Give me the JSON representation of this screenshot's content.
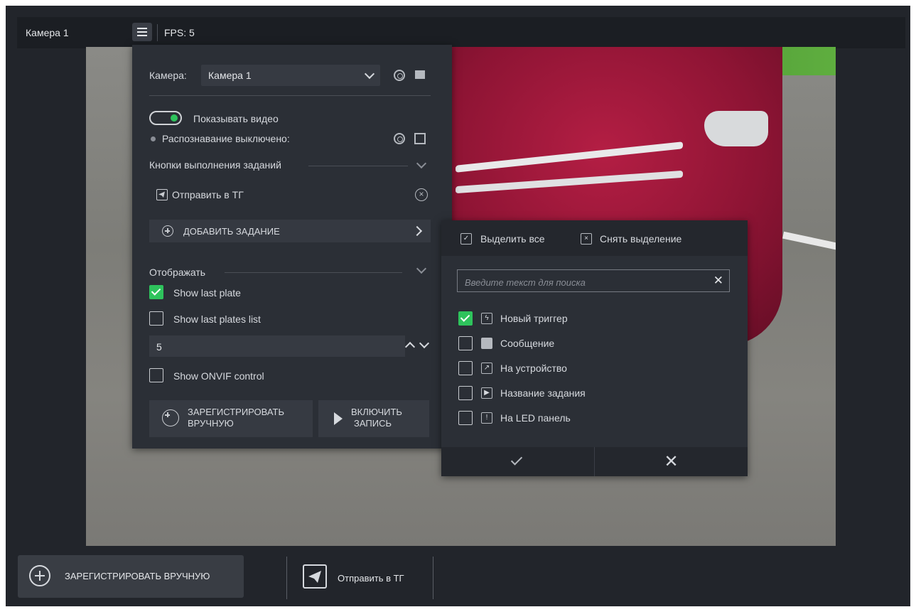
{
  "topbar": {
    "camera": "Камера 1",
    "fps": "FPS: 5"
  },
  "panel": {
    "camera_label": "Камера:",
    "camera_value": "Камера 1",
    "show_video": "Показывать видео",
    "recognition": "Распознавание выключено:",
    "task_buttons_header": "Кнопки выполнения заданий",
    "task_item": "Отправить в ТГ",
    "add_task": "ДОБАВИТЬ ЗАДАНИЕ",
    "display_header": "Отображать",
    "show_last_plate": "Show last plate",
    "show_last_plates_list": "Show last plates list",
    "plates_count": "5",
    "show_onvif": "Show ONVIF control",
    "register_line1": "ЗАРЕГИСТРИРОВАТЬ",
    "register_line2": "ВРУЧНУЮ",
    "record_line1": "ВКЛЮЧИТЬ",
    "record_line2": "ЗАПИСЬ"
  },
  "task_picker": {
    "select_all": "Выделить все",
    "deselect": "Снять выделение",
    "search_placeholder": "Введите текст для поиска",
    "items": [
      {
        "label": "Новый триггер",
        "checked": true,
        "icon": "lightning-icon"
      },
      {
        "label": "Сообщение",
        "checked": false,
        "icon": "envelope-icon"
      },
      {
        "label": "На устройство",
        "checked": false,
        "icon": "arrow-up-right-icon"
      },
      {
        "label": "Название задания",
        "checked": false,
        "icon": "play-icon"
      },
      {
        "label": "На LED панель",
        "checked": false,
        "icon": "exclamation-icon"
      }
    ]
  },
  "bottom": {
    "register": "ЗАРЕГИСТРИРОВАТЬ ВРУЧНУЮ",
    "send_tg": "Отправить в ТГ"
  },
  "colors": {
    "accent_green": "#2ec35c",
    "background": "#22252b",
    "panel": "#2b2f36"
  }
}
